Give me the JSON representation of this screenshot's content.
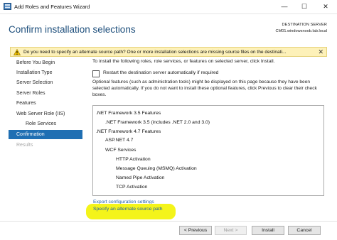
{
  "window": {
    "title": "Add Roles and Features Wizard",
    "minimize": "—",
    "maximize": "☐",
    "close": "✕"
  },
  "header": {
    "page_title": "Confirm installation selections",
    "destination_label": "DESTINATION SERVER",
    "destination_server": "CM01.windowsnoob.lab.local"
  },
  "warning": {
    "text": "Do you need to specify an alternate source path? One or more installation selections are missing source files on the destinati...",
    "close": "✕"
  },
  "nav": {
    "items": [
      {
        "label": "Before You Begin",
        "state": "normal",
        "level": 0
      },
      {
        "label": "Installation Type",
        "state": "normal",
        "level": 0
      },
      {
        "label": "Server Selection",
        "state": "normal",
        "level": 0
      },
      {
        "label": "Server Roles",
        "state": "normal",
        "level": 0
      },
      {
        "label": "Features",
        "state": "normal",
        "level": 0
      },
      {
        "label": "Web Server Role (IIS)",
        "state": "normal",
        "level": 0
      },
      {
        "label": "Role Services",
        "state": "normal",
        "level": 1
      },
      {
        "label": "Confirmation",
        "state": "active",
        "level": 0
      },
      {
        "label": "Results",
        "state": "disabled",
        "level": 0
      }
    ]
  },
  "content": {
    "intro": "To install the following roles, role services, or features on selected server, click Install.",
    "restart_label": "Restart the destination server automatically if required",
    "optional_text": "Optional features (such as administration tools) might be displayed on this page because they have been selected automatically. If you do not want to install these optional features, click Previous to clear their check boxes.",
    "features": [
      ".NET Framework 3.5 Features",
      ".NET Framework 3.5 (includes .NET 2.0 and 3.0)",
      ".NET Framework 4.7 Features",
      "ASP.NET 4.7",
      "WCF Services",
      "HTTP Activation",
      "Message Queuing (MSMQ) Activation",
      "Named Pipe Activation",
      "TCP Activation"
    ],
    "export_link": "Export configuration settings",
    "alternate_link": "Specify an alternate source path"
  },
  "buttons": {
    "previous": "< Previous",
    "next": "Next >",
    "install": "Install",
    "cancel": "Cancel"
  },
  "colors": {
    "accent": "#1f6fb3",
    "title": "#1e4f7c",
    "warning_bg": "#fdf1b9",
    "highlight": "#f4f41a",
    "link": "#1e5fa8"
  }
}
